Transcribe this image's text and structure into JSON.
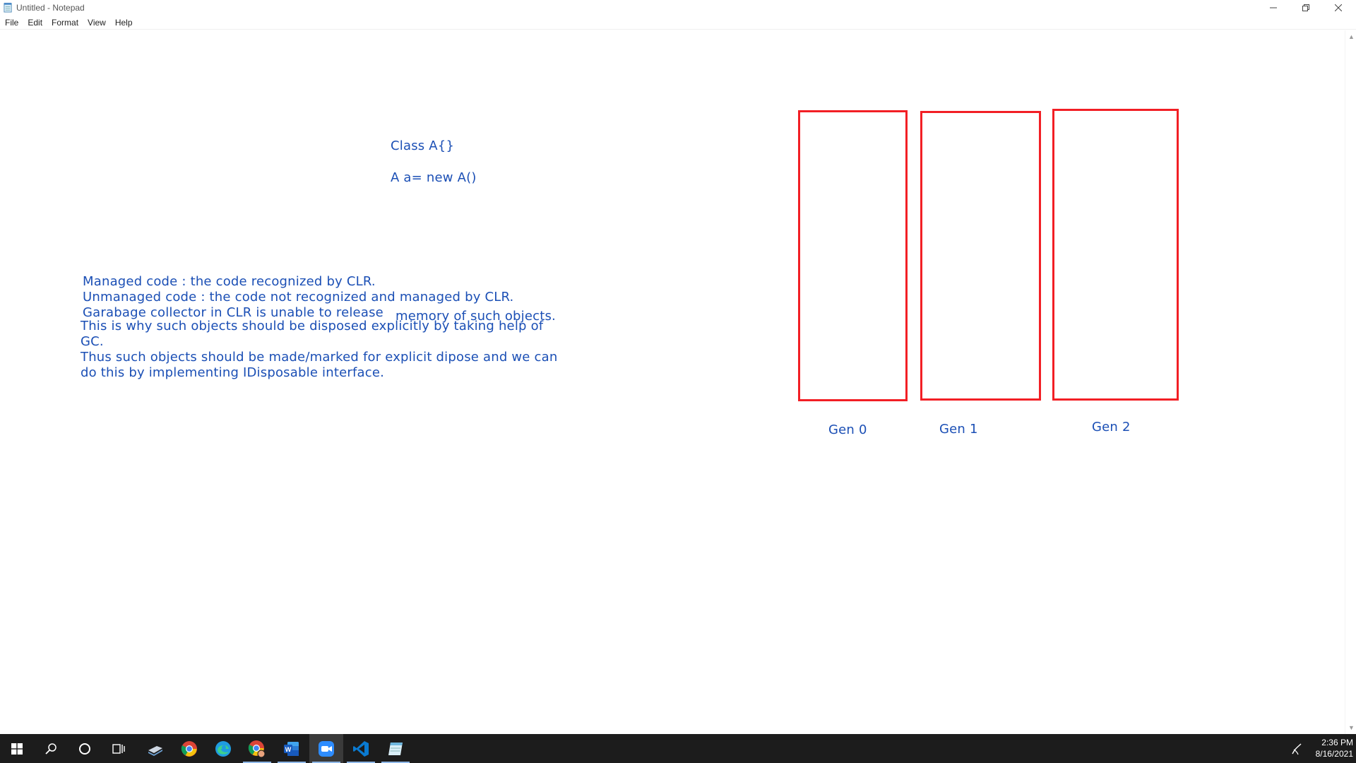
{
  "window": {
    "title": "Untitled - Notepad"
  },
  "menu": [
    "File",
    "Edit",
    "Format",
    "View",
    "Help"
  ],
  "notes": {
    "class_decl": "Class A{}",
    "instantiation": "A a= new A()",
    "line1": "Managed code : the code recognized by CLR.",
    "line2": "Unmanaged code :  the code not recognized and managed by CLR.",
    "line3a": "Garabage collector in CLR is unable to release",
    "line3b": "memory of such objects.",
    "line4": "This is why such objects should be disposed explicitly by taking help of",
    "line5": "GC.",
    "line6": "Thus such objects should be made/marked for explicit dipose and we can",
    "line7": "do this by implementing IDisposable interface."
  },
  "generations": [
    {
      "label": "Gen 0"
    },
    {
      "label": "Gen 1"
    },
    {
      "label": "Gen 2"
    }
  ],
  "taskbar": {
    "apps": [
      "windows-start-icon",
      "search-icon",
      "cortana-icon",
      "task-view-icon",
      "file-explorer-icon",
      "chrome-icon",
      "edge-icon",
      "chrome-profile-icon",
      "word-icon",
      "zoom-icon",
      "vscode-icon",
      "notepad-icon"
    ],
    "time": "2:36 PM",
    "date": "8/16/2021"
  },
  "colors": {
    "ink": "#1b4fb5",
    "box_stroke": "#f21f25",
    "taskbar": "#1c1c1c"
  }
}
